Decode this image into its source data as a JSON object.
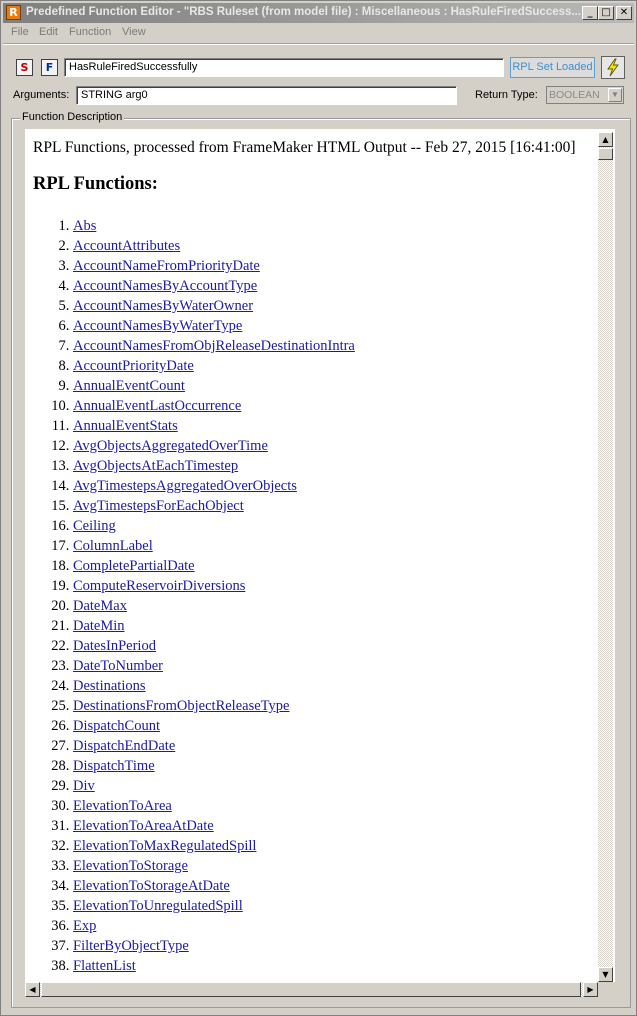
{
  "window": {
    "title": "Predefined Function Editor - \"RBS Ruleset (from model file) : Miscellaneous : HasRuleFiredSuccess...",
    "app_icon": "R",
    "controls": {
      "minimize": "_",
      "maximize": "□",
      "close": "✕"
    }
  },
  "menu": [
    "File",
    "Edit",
    "Function",
    "View"
  ],
  "toolbar": {
    "s_button": "S",
    "f_button": "F",
    "function_name": "HasRuleFiredSuccessfully",
    "rpl_status": "RPL Set Loaded",
    "bolt_icon": "lightning-icon"
  },
  "arguments": {
    "label": "Arguments:",
    "value": "STRING arg0",
    "return_label": "Return Type:",
    "return_value": "BOOLEAN"
  },
  "description": {
    "group_title": "Function Description",
    "header": "RPL Functions, processed from FrameMaker HTML Output -- Feb 27, 2015 [16:41:00]",
    "heading": "RPL Functions:",
    "functions": [
      "Abs",
      "AccountAttributes",
      "AccountNameFromPriorityDate",
      "AccountNamesByAccountType",
      "AccountNamesByWaterOwner",
      "AccountNamesByWaterType",
      "AccountNamesFromObjReleaseDestinationIntra",
      "AccountPriorityDate",
      "AnnualEventCount",
      "AnnualEventLastOccurrence",
      "AnnualEventStats",
      "AvgObjectsAggregatedOverTime",
      "AvgObjectsAtEachTimestep",
      "AvgTimestepsAggregatedOverObjects",
      "AvgTimestepsForEachObject",
      "Ceiling",
      "ColumnLabel",
      "CompletePartialDate",
      "ComputeReservoirDiversions",
      "DateMax",
      "DateMin",
      "DatesInPeriod",
      "DateToNumber",
      "Destinations",
      "DestinationsFromObjectReleaseType",
      "DispatchCount",
      "DispatchEndDate",
      "DispatchTime",
      "Div",
      "ElevationToArea",
      "ElevationToAreaAtDate",
      "ElevationToMaxRegulatedSpill",
      "ElevationToStorage",
      "ElevationToStorageAtDate",
      "ElevationToUnregulatedSpill",
      "Exp",
      "FilterByObjectType",
      "FlattenList"
    ]
  }
}
